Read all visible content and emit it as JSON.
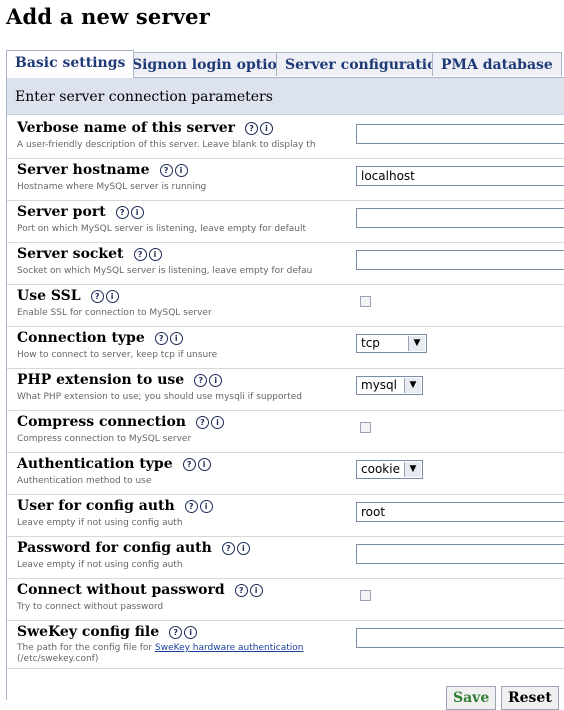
{
  "page": {
    "title": "Add a new server"
  },
  "tabs": [
    {
      "label": "Basic settings",
      "active": true
    },
    {
      "label": "Signon login options",
      "active": false
    },
    {
      "label": "Server configuration",
      "active": false
    },
    {
      "label": "PMA database",
      "active": false
    }
  ],
  "section": {
    "header": "Enter server connection parameters"
  },
  "icons": {
    "help": "?",
    "info": "i"
  },
  "fields": [
    {
      "label": "Verbose name of this server",
      "desc": "A user-friendly description of this server. Leave blank to display th",
      "type": "text",
      "value": ""
    },
    {
      "label": "Server hostname",
      "desc": "Hostname where MySQL server is running",
      "type": "text",
      "value": "localhost"
    },
    {
      "label": "Server port",
      "desc": "Port on which MySQL server is listening, leave empty for default",
      "type": "text",
      "value": ""
    },
    {
      "label": "Server socket",
      "desc": "Socket on which MySQL server is listening, leave empty for defau",
      "type": "text",
      "value": ""
    },
    {
      "label": "Use SSL",
      "desc": "Enable SSL for connection to MySQL server",
      "type": "checkbox",
      "checked": false
    },
    {
      "label": "Connection type",
      "desc": "How to connect to server, keep tcp if unsure",
      "type": "select",
      "value": "tcp"
    },
    {
      "label": "PHP extension to use",
      "desc": "What PHP extension to use; you should use mysqli if supported",
      "type": "select",
      "value": "mysql"
    },
    {
      "label": "Compress connection",
      "desc": "Compress connection to MySQL server",
      "type": "checkbox",
      "checked": false
    },
    {
      "label": "Authentication type",
      "desc": "Authentication method to use",
      "type": "select",
      "value": "cookie"
    },
    {
      "label": "User for config auth",
      "desc": "Leave empty if not using config auth",
      "type": "text",
      "value": "root"
    },
    {
      "label": "Password for config auth",
      "desc": "Leave empty if not using config auth",
      "type": "text",
      "value": ""
    },
    {
      "label": "Connect without password",
      "desc": "Try to connect without password",
      "type": "checkbox",
      "checked": false
    },
    {
      "label": "SweKey config file",
      "desc_prefix": "The path for the config file for ",
      "desc_link": "SweKey hardware authentication",
      "desc_suffix": " (/etc/swekey.conf)",
      "type": "text",
      "value": ""
    }
  ],
  "buttons": {
    "save": "Save",
    "reset": "Reset"
  }
}
